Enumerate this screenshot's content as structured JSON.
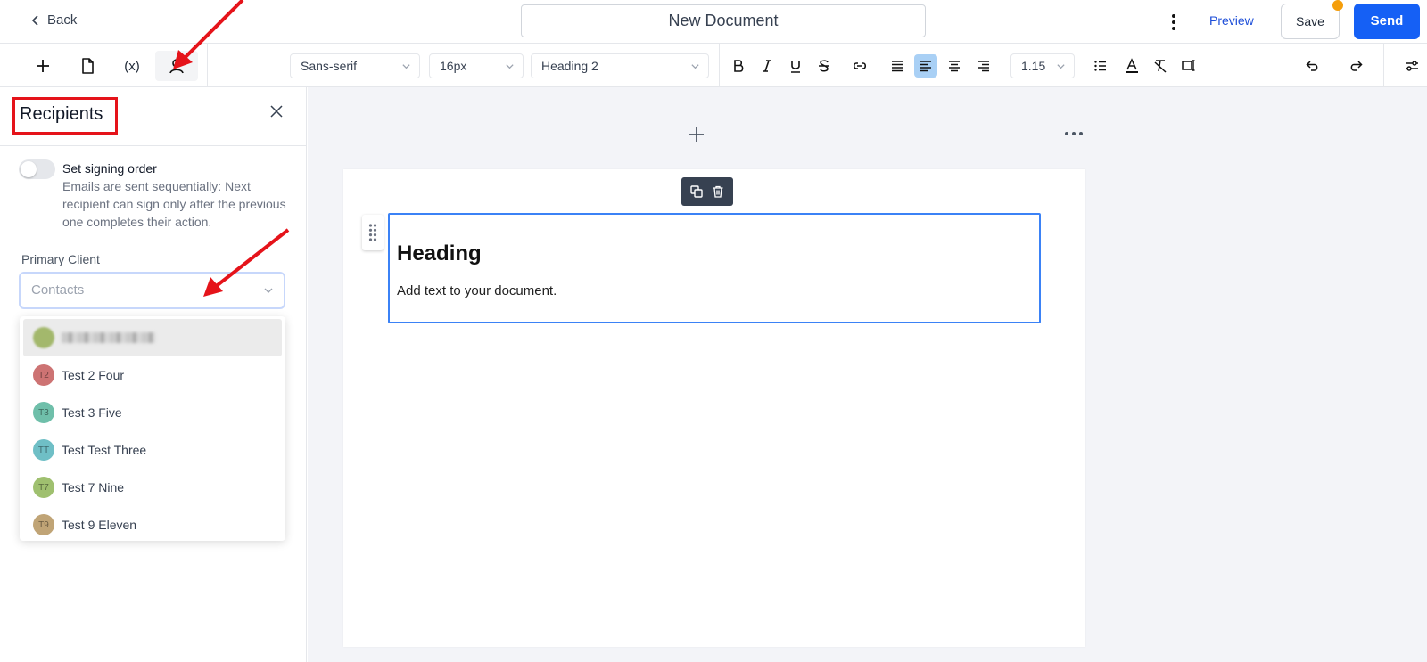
{
  "topbar": {
    "back_label": "Back",
    "document_title": "New Document",
    "preview_label": "Preview",
    "save_label": "Save",
    "send_label": "Send"
  },
  "toolbar": {
    "font_family": "Sans-serif",
    "font_size": "16px",
    "block_style": "Heading 2",
    "line_height": "1.15",
    "variable_label": "(x)",
    "active_alignment": "left"
  },
  "sidebar": {
    "title": "Recipients",
    "signing_order_label": "Set signing order",
    "signing_order_desc": "Emails are sent sequentially: Next recipient can sign only after the previous one completes their action.",
    "signing_order_enabled": false,
    "primary_client_label": "Primary Client",
    "contacts_placeholder": "Contacts",
    "contacts": [
      {
        "initials": "",
        "name": "",
        "color": "#a3b86c",
        "redacted": true
      },
      {
        "initials": "T2",
        "name": "Test 2 Four",
        "color": "#cd7373"
      },
      {
        "initials": "T3",
        "name": "Test 3 Five",
        "color": "#6fbfaa"
      },
      {
        "initials": "TT",
        "name": "Test Test Three",
        "color": "#6fbfc6"
      },
      {
        "initials": "T7",
        "name": "Test 7 Nine",
        "color": "#9fc06f"
      },
      {
        "initials": "T9",
        "name": "Test 9 Eleven",
        "color": "#c0a476"
      }
    ]
  },
  "editor": {
    "heading_text": "Heading",
    "body_text": "Add text to your document."
  },
  "colors": {
    "accent": "#1560f5",
    "annotation_red": "#e5131a",
    "selection_blue": "#3b82f6"
  }
}
